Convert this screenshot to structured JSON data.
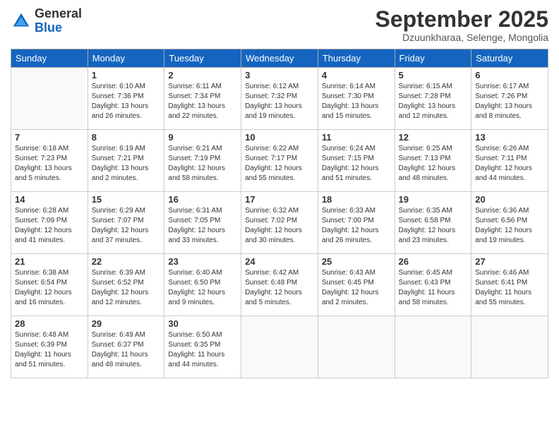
{
  "header": {
    "logo_general": "General",
    "logo_blue": "Blue",
    "month_title": "September 2025",
    "subtitle": "Dzuunkharaa, Selenge, Mongolia"
  },
  "days_of_week": [
    "Sunday",
    "Monday",
    "Tuesday",
    "Wednesday",
    "Thursday",
    "Friday",
    "Saturday"
  ],
  "weeks": [
    [
      {
        "day": "",
        "info": ""
      },
      {
        "day": "1",
        "info": "Sunrise: 6:10 AM\nSunset: 7:36 PM\nDaylight: 13 hours and 26 minutes."
      },
      {
        "day": "2",
        "info": "Sunrise: 6:11 AM\nSunset: 7:34 PM\nDaylight: 13 hours and 22 minutes."
      },
      {
        "day": "3",
        "info": "Sunrise: 6:12 AM\nSunset: 7:32 PM\nDaylight: 13 hours and 19 minutes."
      },
      {
        "day": "4",
        "info": "Sunrise: 6:14 AM\nSunset: 7:30 PM\nDaylight: 13 hours and 15 minutes."
      },
      {
        "day": "5",
        "info": "Sunrise: 6:15 AM\nSunset: 7:28 PM\nDaylight: 13 hours and 12 minutes."
      },
      {
        "day": "6",
        "info": "Sunrise: 6:17 AM\nSunset: 7:26 PM\nDaylight: 13 hours and 8 minutes."
      }
    ],
    [
      {
        "day": "7",
        "info": "Sunrise: 6:18 AM\nSunset: 7:23 PM\nDaylight: 13 hours and 5 minutes."
      },
      {
        "day": "8",
        "info": "Sunrise: 6:19 AM\nSunset: 7:21 PM\nDaylight: 13 hours and 2 minutes."
      },
      {
        "day": "9",
        "info": "Sunrise: 6:21 AM\nSunset: 7:19 PM\nDaylight: 12 hours and 58 minutes."
      },
      {
        "day": "10",
        "info": "Sunrise: 6:22 AM\nSunset: 7:17 PM\nDaylight: 12 hours and 55 minutes."
      },
      {
        "day": "11",
        "info": "Sunrise: 6:24 AM\nSunset: 7:15 PM\nDaylight: 12 hours and 51 minutes."
      },
      {
        "day": "12",
        "info": "Sunrise: 6:25 AM\nSunset: 7:13 PM\nDaylight: 12 hours and 48 minutes."
      },
      {
        "day": "13",
        "info": "Sunrise: 6:26 AM\nSunset: 7:11 PM\nDaylight: 12 hours and 44 minutes."
      }
    ],
    [
      {
        "day": "14",
        "info": "Sunrise: 6:28 AM\nSunset: 7:09 PM\nDaylight: 12 hours and 41 minutes."
      },
      {
        "day": "15",
        "info": "Sunrise: 6:29 AM\nSunset: 7:07 PM\nDaylight: 12 hours and 37 minutes."
      },
      {
        "day": "16",
        "info": "Sunrise: 6:31 AM\nSunset: 7:05 PM\nDaylight: 12 hours and 33 minutes."
      },
      {
        "day": "17",
        "info": "Sunrise: 6:32 AM\nSunset: 7:02 PM\nDaylight: 12 hours and 30 minutes."
      },
      {
        "day": "18",
        "info": "Sunrise: 6:33 AM\nSunset: 7:00 PM\nDaylight: 12 hours and 26 minutes."
      },
      {
        "day": "19",
        "info": "Sunrise: 6:35 AM\nSunset: 6:58 PM\nDaylight: 12 hours and 23 minutes."
      },
      {
        "day": "20",
        "info": "Sunrise: 6:36 AM\nSunset: 6:56 PM\nDaylight: 12 hours and 19 minutes."
      }
    ],
    [
      {
        "day": "21",
        "info": "Sunrise: 6:38 AM\nSunset: 6:54 PM\nDaylight: 12 hours and 16 minutes."
      },
      {
        "day": "22",
        "info": "Sunrise: 6:39 AM\nSunset: 6:52 PM\nDaylight: 12 hours and 12 minutes."
      },
      {
        "day": "23",
        "info": "Sunrise: 6:40 AM\nSunset: 6:50 PM\nDaylight: 12 hours and 9 minutes."
      },
      {
        "day": "24",
        "info": "Sunrise: 6:42 AM\nSunset: 6:48 PM\nDaylight: 12 hours and 5 minutes."
      },
      {
        "day": "25",
        "info": "Sunrise: 6:43 AM\nSunset: 6:45 PM\nDaylight: 12 hours and 2 minutes."
      },
      {
        "day": "26",
        "info": "Sunrise: 6:45 AM\nSunset: 6:43 PM\nDaylight: 11 hours and 58 minutes."
      },
      {
        "day": "27",
        "info": "Sunrise: 6:46 AM\nSunset: 6:41 PM\nDaylight: 11 hours and 55 minutes."
      }
    ],
    [
      {
        "day": "28",
        "info": "Sunrise: 6:48 AM\nSunset: 6:39 PM\nDaylight: 11 hours and 51 minutes."
      },
      {
        "day": "29",
        "info": "Sunrise: 6:49 AM\nSunset: 6:37 PM\nDaylight: 11 hours and 48 minutes."
      },
      {
        "day": "30",
        "info": "Sunrise: 6:50 AM\nSunset: 6:35 PM\nDaylight: 11 hours and 44 minutes."
      },
      {
        "day": "",
        "info": ""
      },
      {
        "day": "",
        "info": ""
      },
      {
        "day": "",
        "info": ""
      },
      {
        "day": "",
        "info": ""
      }
    ]
  ]
}
